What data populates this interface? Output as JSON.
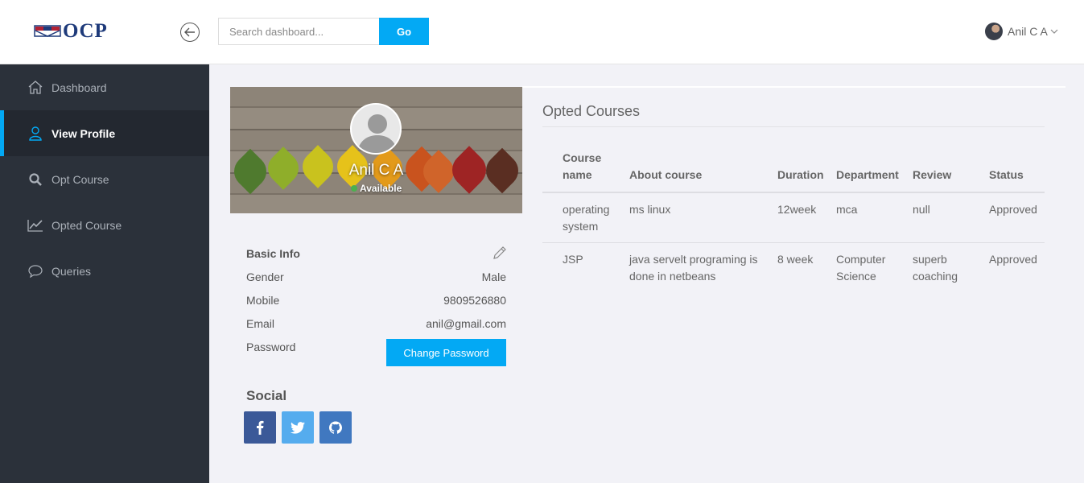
{
  "header": {
    "logo_text": "OCP",
    "search_placeholder": "Search dashboard...",
    "search_value": "",
    "go_label": "Go",
    "user_name": "Anil C A"
  },
  "sidebar": {
    "items": [
      {
        "label": "Dashboard",
        "icon": "home-icon",
        "active": false
      },
      {
        "label": "View Profile",
        "icon": "user-icon",
        "active": true
      },
      {
        "label": "Opt Course",
        "icon": "search-icon",
        "active": false
      },
      {
        "label": "Opted Course",
        "icon": "chart-line-icon",
        "active": false
      },
      {
        "label": "Queries",
        "icon": "chat-bubble-icon",
        "active": false
      }
    ]
  },
  "profile": {
    "name": "Anil C A",
    "status": "Available",
    "status_color": "#4caf50",
    "basic_info_title": "Basic Info",
    "fields": [
      {
        "label": "Gender",
        "value": "Male"
      },
      {
        "label": "Mobile",
        "value": "9809526880"
      },
      {
        "label": "Email",
        "value": "anil@gmail.com"
      },
      {
        "label": "Password",
        "value": ""
      }
    ],
    "change_password_label": "Change Password",
    "social_title": "Social",
    "social": [
      {
        "icon": "facebook-icon",
        "color": "#3b5998"
      },
      {
        "icon": "twitter-icon",
        "color": "#55acee"
      },
      {
        "icon": "github-icon",
        "color": "#4078c0"
      }
    ]
  },
  "courses": {
    "title": "Opted Courses",
    "columns": [
      "Course name",
      "About course",
      "Duration",
      "Department",
      "Review",
      "Status"
    ],
    "rows": [
      [
        "operating system",
        "ms linux",
        "12week",
        "mca",
        "null",
        "Approved"
      ],
      [
        "JSP",
        "java servelt programing is done in netbeans",
        "8 week",
        "Computer Science",
        "superb coaching",
        "Approved"
      ]
    ]
  },
  "colors": {
    "accent": "#03a9f4",
    "sidebar_bg": "#2b313a",
    "page_bg": "#f2f2f7"
  }
}
